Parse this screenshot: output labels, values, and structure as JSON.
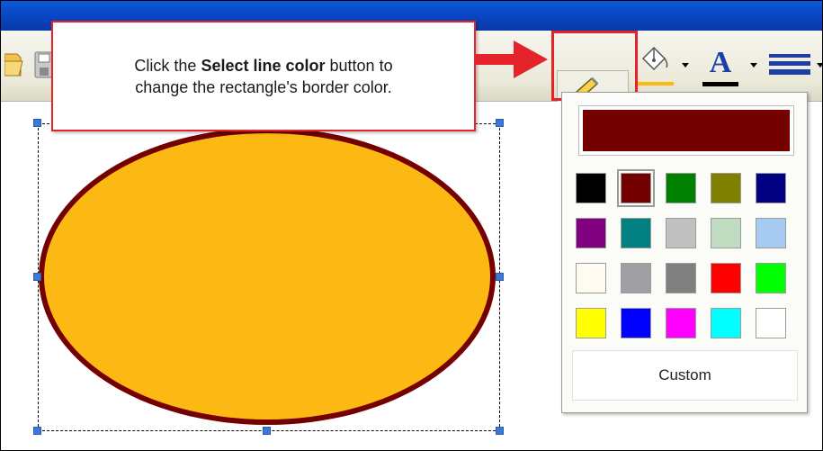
{
  "callout": {
    "text_before": "Click the ",
    "text_bold": "Select line color",
    "text_after": " button to",
    "text_line2": "change the rectangle's border color."
  },
  "toolbar": {
    "line_color_button": "Select line color",
    "icons": [
      "open-folder-icon",
      "save-icon",
      "pencil-icon",
      "paint-bucket-icon",
      "font-color-icon",
      "line-style-icon"
    ],
    "current_line_color": "#740000",
    "fill_color_indicator": "#fdb913",
    "font_color_indicator": "#000000"
  },
  "canvas": {
    "shape": "ellipse",
    "fill_color": "#fdb913",
    "border_color": "#740000"
  },
  "color_panel": {
    "preview_color": "#740000",
    "swatches": [
      "#000000",
      "#740000",
      "#008000",
      "#808000",
      "#000080",
      "#800080",
      "#008080",
      "#c0c0c0",
      "#c0dcc0",
      "#a6caf0",
      "#fffbf0",
      "#a0a0a4",
      "#808080",
      "#ff0000",
      "#00ff00",
      "#ffff00",
      "#0000ff",
      "#ff00ff",
      "#00ffff",
      "#ffffff"
    ],
    "selected_swatch_index": 1,
    "custom_label": "Custom"
  }
}
